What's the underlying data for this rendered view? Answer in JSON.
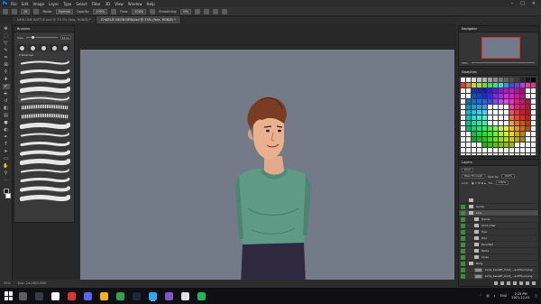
{
  "menubar": {
    "app_icon": "Ps",
    "items": [
      "File",
      "Edit",
      "Image",
      "Layer",
      "Type",
      "Select",
      "Filter",
      "3D",
      "View",
      "Window",
      "Help"
    ]
  },
  "options": {
    "brush_size": "16",
    "mode_label": "Mode:",
    "mode_value": "Normal",
    "opacity_label": "Opacity:",
    "opacity_value": "100%",
    "flow_label": "Flow:",
    "flow_value": "100%",
    "smoothing_label": "Smoothing:",
    "smoothing_value": "0%"
  },
  "tabs": [
    {
      "label": "NEW ONE BATTLE.psd @ 33.3% (Img, RGB/8) *",
      "active": false
    },
    {
      "label": "CHARLIE NEON NEW.psd @ 33% (fore, RGB/8) *",
      "active": true
    }
  ],
  "brushes_panel": {
    "title": "Brushes",
    "size_label": "Size:",
    "size_value": "16 px",
    "size_fraction": 0.18,
    "folder_label": "Sketches",
    "stroke_count": 16,
    "selected_index": 4
  },
  "statusbar": {
    "zoom": "33%",
    "doc_info": "Doc: 24.0M/1.06G"
  },
  "navigator": {
    "title": "Navigator",
    "zoom": "33%"
  },
  "swatches": {
    "title": "Swatches"
  },
  "layers": {
    "title": "Layers",
    "kind_label": "Kind",
    "blend_mode": "Pass Through",
    "opacity_label": "Opacity:",
    "opacity_value": "100%",
    "lock_label": "Lock:",
    "fill_label": "Fill:",
    "fill_value": "100%",
    "items": [
      {
        "name": "",
        "type": "folder",
        "indent": 0,
        "visible": false,
        "selected": false
      },
      {
        "name": "Guide",
        "type": "folder",
        "indent": 0,
        "visible": true,
        "selected": false
      },
      {
        "name": "Line",
        "type": "folder",
        "indent": 0,
        "visible": true,
        "selected": true
      },
      {
        "name": "Hands",
        "type": "folder",
        "indent": 1,
        "visible": true,
        "selected": false
      },
      {
        "name": "Shirt+Hair",
        "type": "folder",
        "indent": 1,
        "visible": true,
        "selected": false
      },
      {
        "name": "Hair",
        "type": "folder",
        "indent": 1,
        "visible": true,
        "selected": false
      },
      {
        "name": "Hair",
        "type": "folder",
        "indent": 1,
        "visible": true,
        "selected": false
      },
      {
        "name": "Face/Ref",
        "type": "folder",
        "indent": 1,
        "visible": true,
        "selected": false
      },
      {
        "name": "Pants",
        "type": "folder",
        "indent": 1,
        "visible": true,
        "selected": false
      },
      {
        "name": "Lines",
        "type": "folder",
        "indent": 1,
        "visible": true,
        "selected": false
      },
      {
        "name": "Body",
        "type": "folder",
        "indent": 0,
        "visible": true,
        "selected": false
      },
      {
        "name": "body_benefit_front_...ackfrbud.png",
        "type": "image",
        "indent": 1,
        "visible": true,
        "selected": false
      },
      {
        "name": "body_benefit_front_...ackfrbud.png",
        "type": "image",
        "indent": 1,
        "visible": true,
        "selected": false
      },
      {
        "name": "bg",
        "type": "image",
        "indent": 0,
        "visible": true,
        "selected": false
      }
    ]
  },
  "taskbar": {
    "icons": [
      {
        "name": "search-icon",
        "color": "#5f5f5f"
      },
      {
        "name": "task-view-icon",
        "color": "#3a3a44"
      },
      {
        "name": "obs-icon",
        "color": "#ffffff"
      },
      {
        "name": "media-icon",
        "color": "#d8382b"
      },
      {
        "name": "discord-icon",
        "color": "#5865f2"
      },
      {
        "name": "file-explorer-icon",
        "color": "#f3b321"
      },
      {
        "name": "chrome-icon",
        "color": "#2fa44f"
      },
      {
        "name": "steam-icon",
        "color": "#1b2838"
      },
      {
        "name": "photoshop-icon",
        "color": "#31a8ff"
      },
      {
        "name": "app-icon",
        "color": "#7e57c2"
      },
      {
        "name": "app2-icon",
        "color": "#e0e0e0"
      },
      {
        "name": "spotify-icon",
        "color": "#1db954"
      }
    ],
    "language": "ENG",
    "time": "2:25 PM",
    "date": "2021-12-01"
  }
}
